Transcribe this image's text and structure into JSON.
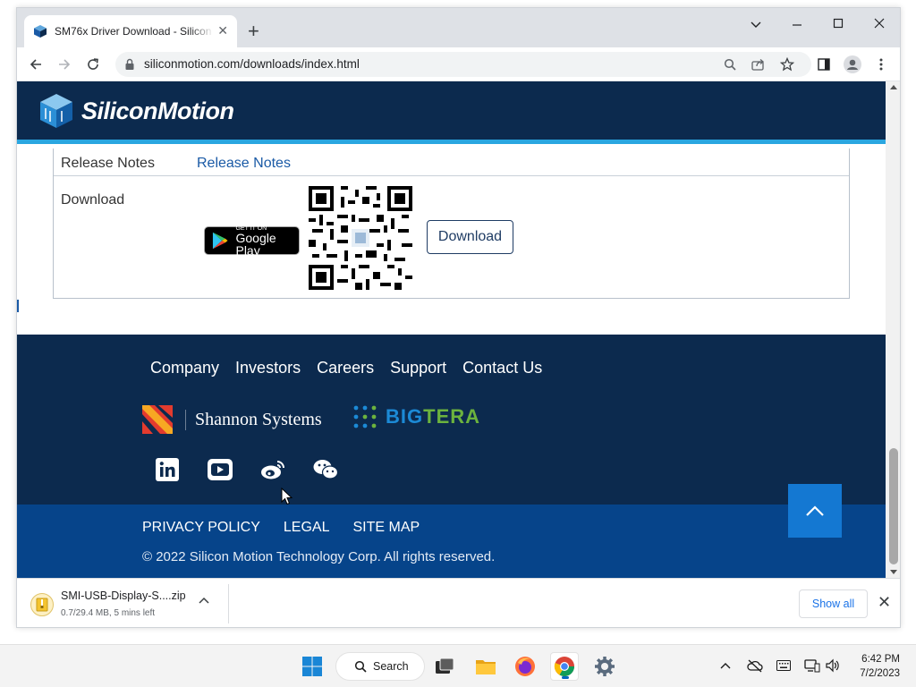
{
  "browser": {
    "tab_title": "SM76x Driver Download - Silicon",
    "new_tab_symbol": "+",
    "url": "siliconmotion.com/downloads/index.html"
  },
  "site": {
    "logo_text": "SiliconMotion",
    "table": {
      "release_notes_label": "Release Notes",
      "release_notes_link": "Release Notes",
      "download_label": "Download",
      "google_play_small": "GET IT ON",
      "google_play_big": "Google Play",
      "download_button": "Download"
    },
    "footer": {
      "nav": [
        "Company",
        "Investors",
        "Careers",
        "Support",
        "Contact Us"
      ],
      "partners": {
        "shannon": "Shannon Systems",
        "bigtera_big": "BIG",
        "bigtera_tera": "TERA"
      },
      "social_icons": [
        "linkedin-icon",
        "youtube-icon",
        "weibo-icon",
        "wechat-icon"
      ],
      "legal": [
        "PRIVACY POLICY",
        "LEGAL",
        "SITE MAP"
      ],
      "copyright": "© 2022 Silicon Motion Technology Corp. All rights reserved."
    }
  },
  "download_shelf": {
    "file_name": "SMI-USB-Display-S....zip",
    "status": "0.7/29.4 MB, 5 mins left",
    "show_all": "Show all"
  },
  "taskbar": {
    "search_label": "Search",
    "time": "6:42 PM",
    "date": "7/2/2023"
  },
  "colors": {
    "header_navy": "#0c2a4e",
    "header_accent": "#2aa6e0",
    "footer_blue": "#06448a",
    "link_blue": "#1a5aa6",
    "back_to_top": "#1478d2",
    "bigtera_blue": "#1c8ad6",
    "bigtera_green": "#6cb33e"
  }
}
